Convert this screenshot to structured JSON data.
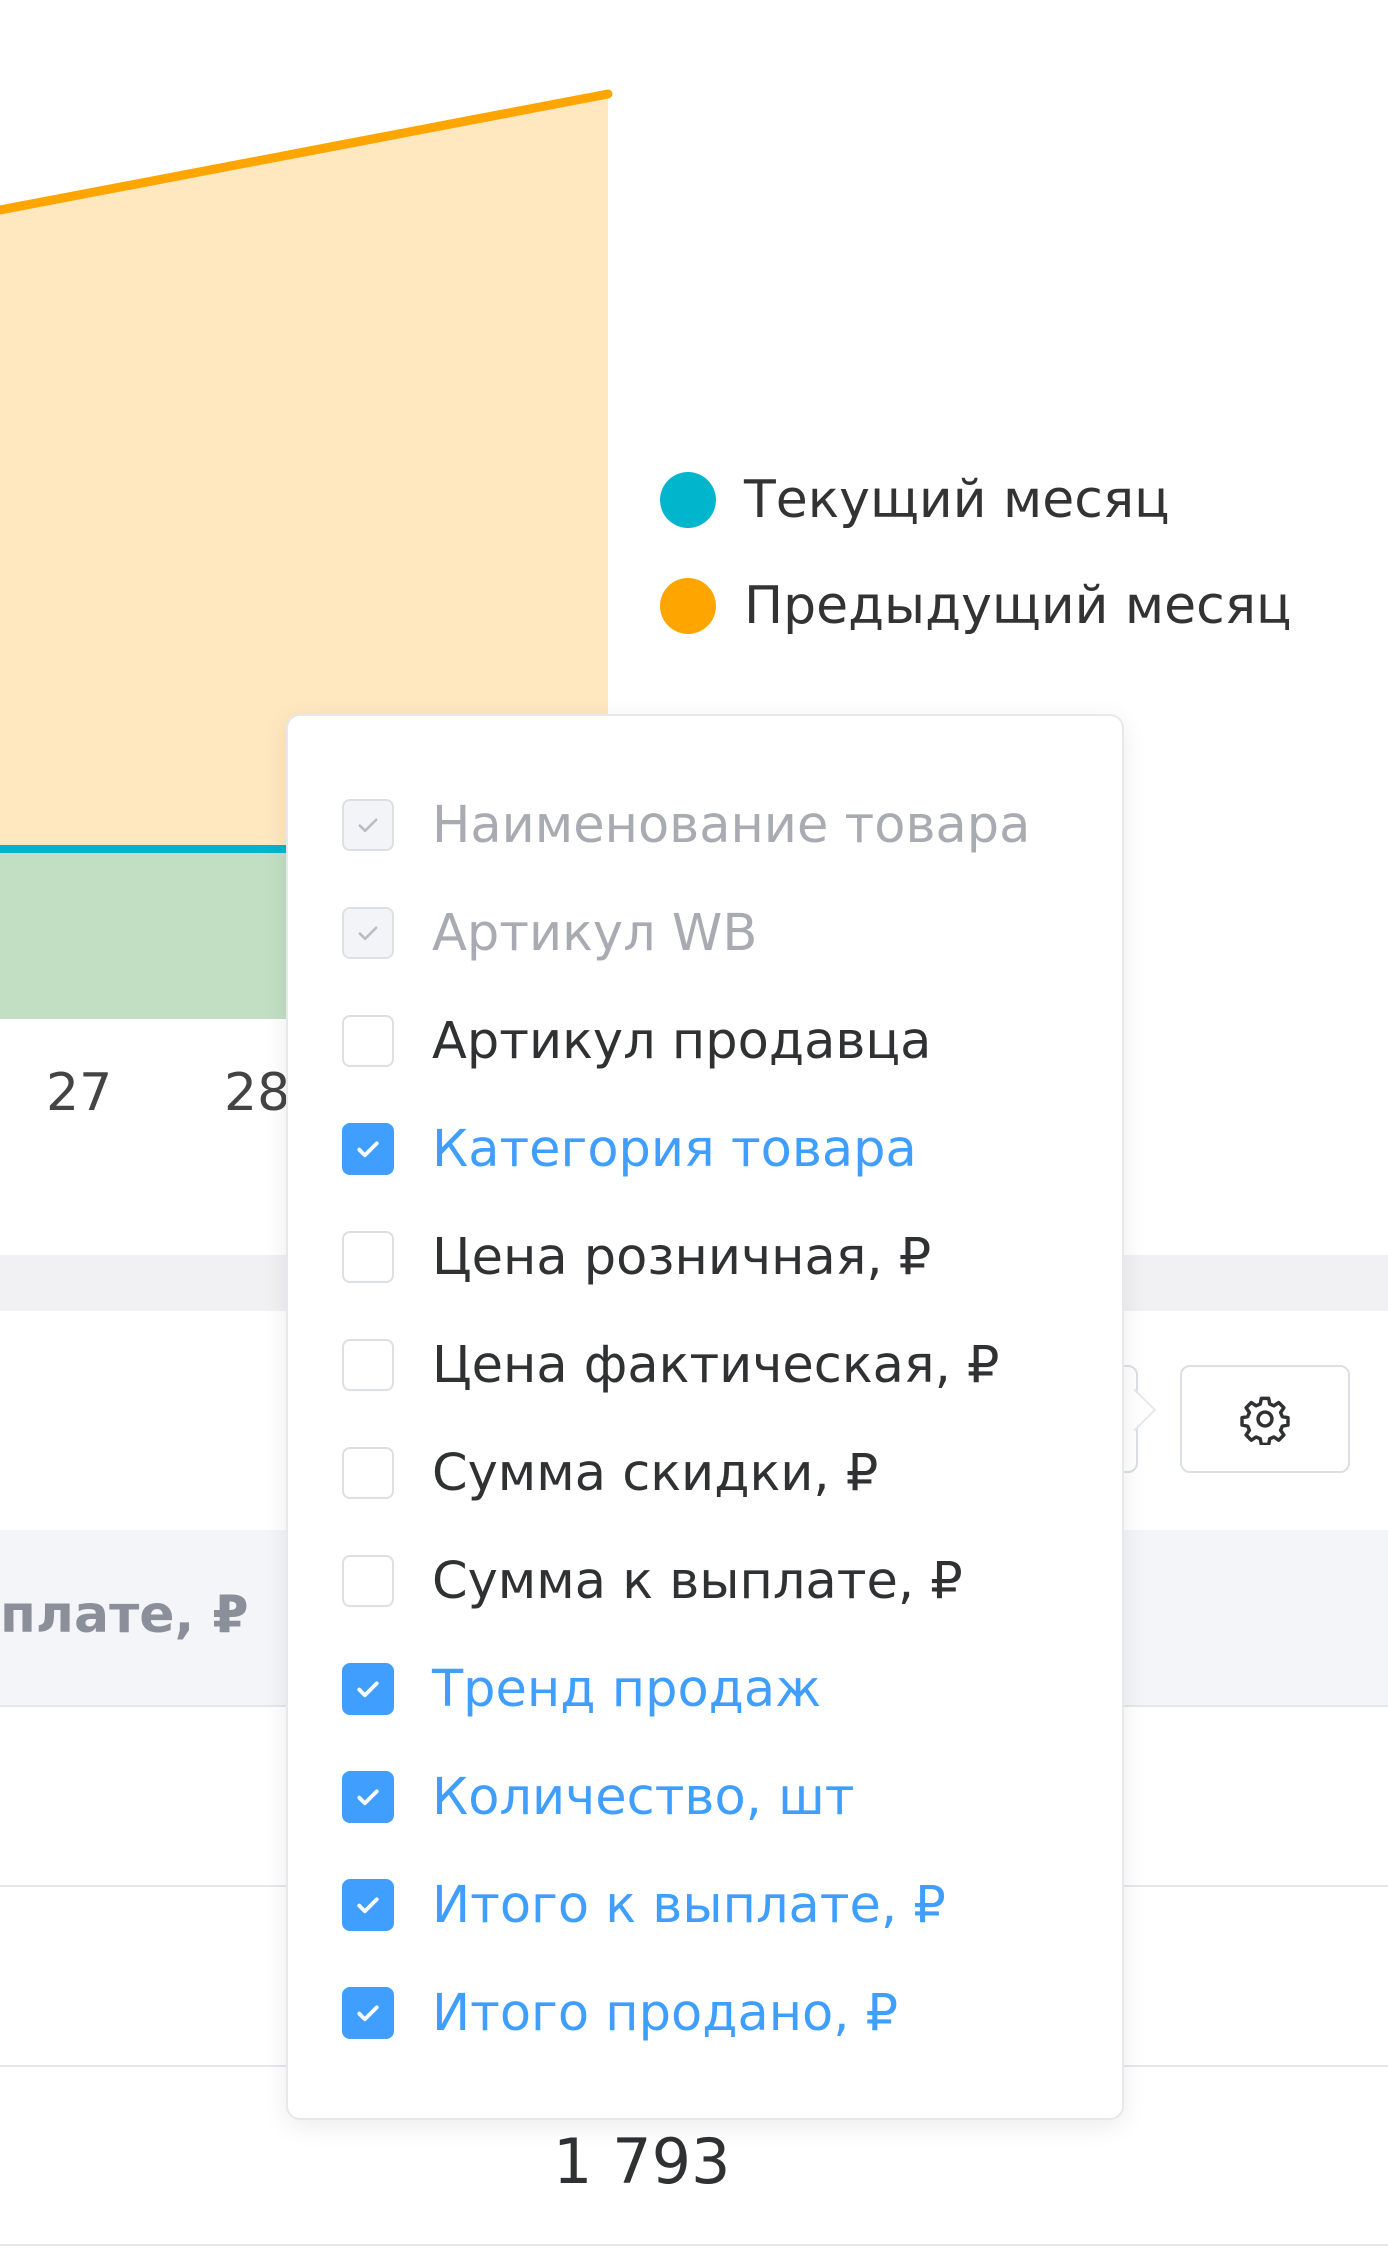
{
  "chart": {
    "legend": [
      {
        "label": "Текущий месяц",
        "color": "#00b5cc"
      },
      {
        "label": "Предыдущий месяц",
        "color": "#ffa500"
      }
    ],
    "x_ticks_visible": [
      "27",
      "28"
    ],
    "colors": {
      "previous_fill": "#ffe8c0",
      "previous_line": "#ffa500",
      "current_fill": "#c2dfc4",
      "current_line": "#00b5cc"
    }
  },
  "toolbar": {
    "settings_icon": "gear-icon"
  },
  "table": {
    "partial_header": "плате, ₽",
    "visible_cell_value": "1 793"
  },
  "column_settings": {
    "options": [
      {
        "label": "Наименование товара",
        "state": "disabled-checked"
      },
      {
        "label": "Артикул WB",
        "state": "disabled-checked"
      },
      {
        "label": "Артикул продавца",
        "state": "unchecked"
      },
      {
        "label": "Категория товара",
        "state": "checked"
      },
      {
        "label": "Цена розничная, ₽",
        "state": "unchecked"
      },
      {
        "label": "Цена фактическая, ₽",
        "state": "unchecked"
      },
      {
        "label": "Сумма скидки, ₽",
        "state": "unchecked"
      },
      {
        "label": "Сумма к выплате, ₽",
        "state": "unchecked"
      },
      {
        "label": "Тренд продаж",
        "state": "checked"
      },
      {
        "label": "Количество, шт",
        "state": "checked"
      },
      {
        "label": "Итого к выплате, ₽",
        "state": "checked"
      },
      {
        "label": "Итого продано, ₽",
        "state": "checked"
      }
    ]
  }
}
